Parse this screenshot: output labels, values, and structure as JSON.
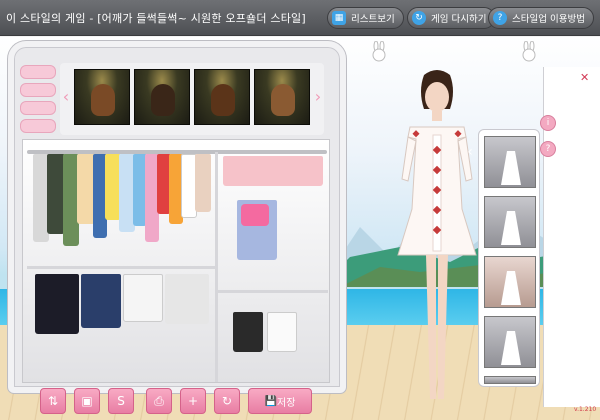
{
  "title": "이 스타일의 게임 - [어깨가 들썩들썩~ 시원한 오프숄더 스타일]",
  "top_buttons": {
    "list": "리스트보기",
    "replay": "게임 다시하기",
    "help": "스타일업 이용방법"
  },
  "icons": {
    "list": "grid-icon",
    "replay": "refresh-icon",
    "help": "question-icon"
  },
  "toolbar": {
    "save_label": "저장"
  },
  "version": "v.1.210",
  "colors": {
    "accent_pink": "#e87da3",
    "topbar": "#5b5d61",
    "sea": "#2fb6e6"
  }
}
